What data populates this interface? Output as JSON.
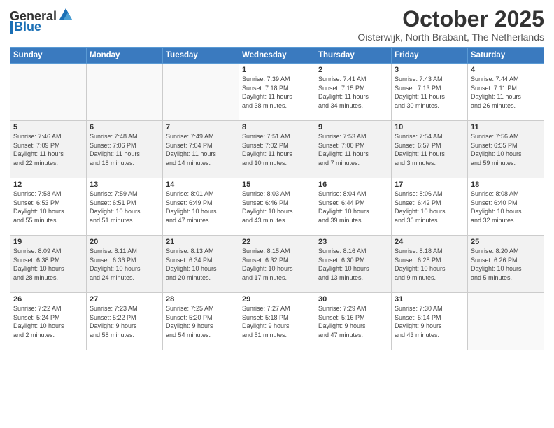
{
  "logo": {
    "general": "General",
    "blue": "Blue"
  },
  "header": {
    "title": "October 2025",
    "subtitle": "Oisterwijk, North Brabant, The Netherlands"
  },
  "weekdays": [
    "Sunday",
    "Monday",
    "Tuesday",
    "Wednesday",
    "Thursday",
    "Friday",
    "Saturday"
  ],
  "weeks": [
    [
      {
        "day": "",
        "info": ""
      },
      {
        "day": "",
        "info": ""
      },
      {
        "day": "",
        "info": ""
      },
      {
        "day": "1",
        "info": "Sunrise: 7:39 AM\nSunset: 7:18 PM\nDaylight: 11 hours\nand 38 minutes."
      },
      {
        "day": "2",
        "info": "Sunrise: 7:41 AM\nSunset: 7:15 PM\nDaylight: 11 hours\nand 34 minutes."
      },
      {
        "day": "3",
        "info": "Sunrise: 7:43 AM\nSunset: 7:13 PM\nDaylight: 11 hours\nand 30 minutes."
      },
      {
        "day": "4",
        "info": "Sunrise: 7:44 AM\nSunset: 7:11 PM\nDaylight: 11 hours\nand 26 minutes."
      }
    ],
    [
      {
        "day": "5",
        "info": "Sunrise: 7:46 AM\nSunset: 7:09 PM\nDaylight: 11 hours\nand 22 minutes."
      },
      {
        "day": "6",
        "info": "Sunrise: 7:48 AM\nSunset: 7:06 PM\nDaylight: 11 hours\nand 18 minutes."
      },
      {
        "day": "7",
        "info": "Sunrise: 7:49 AM\nSunset: 7:04 PM\nDaylight: 11 hours\nand 14 minutes."
      },
      {
        "day": "8",
        "info": "Sunrise: 7:51 AM\nSunset: 7:02 PM\nDaylight: 11 hours\nand 10 minutes."
      },
      {
        "day": "9",
        "info": "Sunrise: 7:53 AM\nSunset: 7:00 PM\nDaylight: 11 hours\nand 7 minutes."
      },
      {
        "day": "10",
        "info": "Sunrise: 7:54 AM\nSunset: 6:57 PM\nDaylight: 11 hours\nand 3 minutes."
      },
      {
        "day": "11",
        "info": "Sunrise: 7:56 AM\nSunset: 6:55 PM\nDaylight: 10 hours\nand 59 minutes."
      }
    ],
    [
      {
        "day": "12",
        "info": "Sunrise: 7:58 AM\nSunset: 6:53 PM\nDaylight: 10 hours\nand 55 minutes."
      },
      {
        "day": "13",
        "info": "Sunrise: 7:59 AM\nSunset: 6:51 PM\nDaylight: 10 hours\nand 51 minutes."
      },
      {
        "day": "14",
        "info": "Sunrise: 8:01 AM\nSunset: 6:49 PM\nDaylight: 10 hours\nand 47 minutes."
      },
      {
        "day": "15",
        "info": "Sunrise: 8:03 AM\nSunset: 6:46 PM\nDaylight: 10 hours\nand 43 minutes."
      },
      {
        "day": "16",
        "info": "Sunrise: 8:04 AM\nSunset: 6:44 PM\nDaylight: 10 hours\nand 39 minutes."
      },
      {
        "day": "17",
        "info": "Sunrise: 8:06 AM\nSunset: 6:42 PM\nDaylight: 10 hours\nand 36 minutes."
      },
      {
        "day": "18",
        "info": "Sunrise: 8:08 AM\nSunset: 6:40 PM\nDaylight: 10 hours\nand 32 minutes."
      }
    ],
    [
      {
        "day": "19",
        "info": "Sunrise: 8:09 AM\nSunset: 6:38 PM\nDaylight: 10 hours\nand 28 minutes."
      },
      {
        "day": "20",
        "info": "Sunrise: 8:11 AM\nSunset: 6:36 PM\nDaylight: 10 hours\nand 24 minutes."
      },
      {
        "day": "21",
        "info": "Sunrise: 8:13 AM\nSunset: 6:34 PM\nDaylight: 10 hours\nand 20 minutes."
      },
      {
        "day": "22",
        "info": "Sunrise: 8:15 AM\nSunset: 6:32 PM\nDaylight: 10 hours\nand 17 minutes."
      },
      {
        "day": "23",
        "info": "Sunrise: 8:16 AM\nSunset: 6:30 PM\nDaylight: 10 hours\nand 13 minutes."
      },
      {
        "day": "24",
        "info": "Sunrise: 8:18 AM\nSunset: 6:28 PM\nDaylight: 10 hours\nand 9 minutes."
      },
      {
        "day": "25",
        "info": "Sunrise: 8:20 AM\nSunset: 6:26 PM\nDaylight: 10 hours\nand 5 minutes."
      }
    ],
    [
      {
        "day": "26",
        "info": "Sunrise: 7:22 AM\nSunset: 5:24 PM\nDaylight: 10 hours\nand 2 minutes."
      },
      {
        "day": "27",
        "info": "Sunrise: 7:23 AM\nSunset: 5:22 PM\nDaylight: 9 hours\nand 58 minutes."
      },
      {
        "day": "28",
        "info": "Sunrise: 7:25 AM\nSunset: 5:20 PM\nDaylight: 9 hours\nand 54 minutes."
      },
      {
        "day": "29",
        "info": "Sunrise: 7:27 AM\nSunset: 5:18 PM\nDaylight: 9 hours\nand 51 minutes."
      },
      {
        "day": "30",
        "info": "Sunrise: 7:29 AM\nSunset: 5:16 PM\nDaylight: 9 hours\nand 47 minutes."
      },
      {
        "day": "31",
        "info": "Sunrise: 7:30 AM\nSunset: 5:14 PM\nDaylight: 9 hours\nand 43 minutes."
      },
      {
        "day": "",
        "info": ""
      }
    ]
  ]
}
